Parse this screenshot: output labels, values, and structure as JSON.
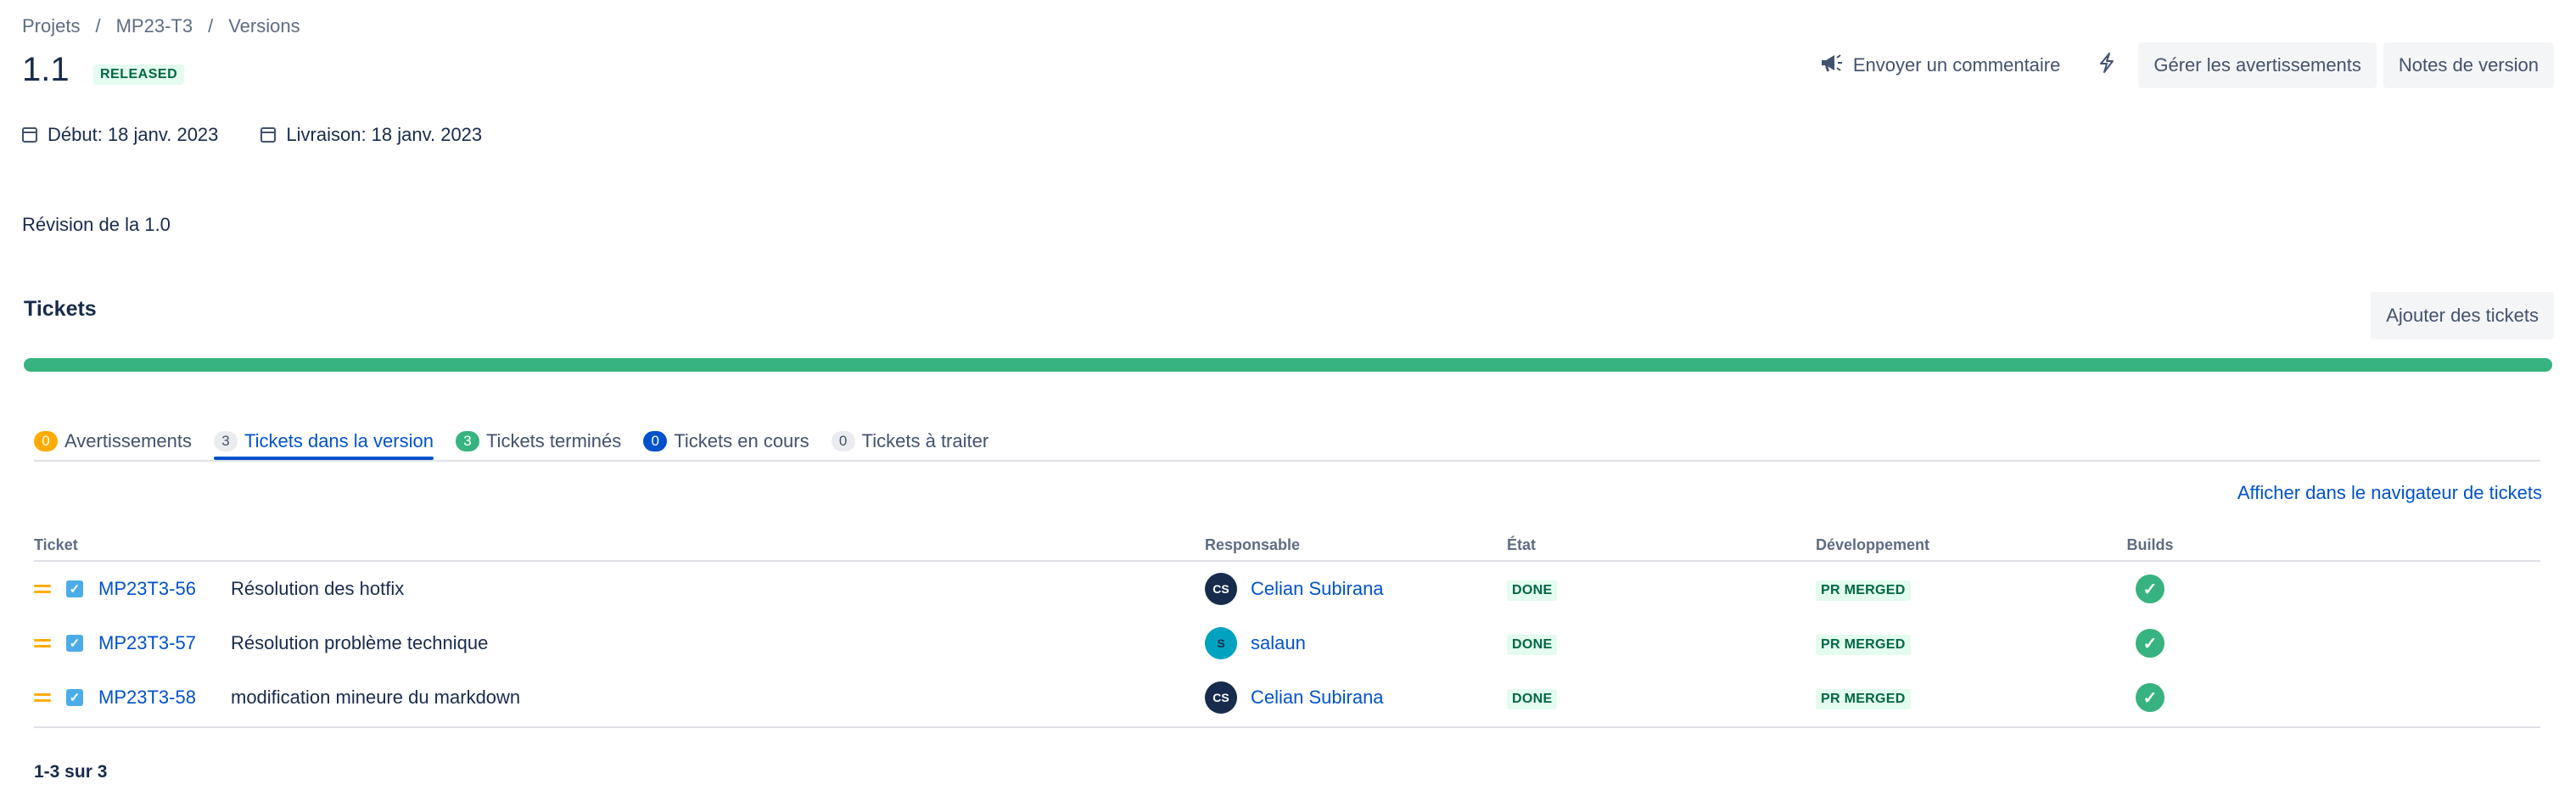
{
  "breadcrumb": [
    "Projets",
    "MP23-T3",
    "Versions"
  ],
  "breadcrumb_sep": "/",
  "version": {
    "name": "1.1",
    "status": "RELEASED",
    "start": "Début: 18 janv. 2023",
    "release": "Livraison: 18 janv. 2023",
    "description": "Révision de la 1.0"
  },
  "actions": {
    "feedback": "Envoyer un commentaire",
    "warnings": "Gérer les avertissements",
    "notes": "Notes de version"
  },
  "tickets_section": {
    "title": "Tickets",
    "add_button": "Ajouter des tickets",
    "progress": 1.0
  },
  "tabs": [
    {
      "count": "0",
      "label": "Avertissements",
      "color": "#ffab00"
    },
    {
      "count": "3",
      "label": "Tickets dans la version",
      "active": true
    },
    {
      "count": "3",
      "label": "Tickets terminés",
      "color": "#36b37e"
    },
    {
      "count": "0",
      "label": "Tickets en cours",
      "color": "#0052cc"
    },
    {
      "count": "0",
      "label": "Tickets à traiter"
    }
  ],
  "navigator_link": "Afficher dans le navigateur de tickets",
  "table": {
    "headers": [
      "Ticket",
      "Responsable",
      "État",
      "Développement",
      "Builds"
    ],
    "rows": [
      {
        "key": "MP23T3-56",
        "summary": "Résolution des hotfix",
        "assignee": "Celian Subirana",
        "initials": "CS",
        "state": "DONE",
        "dev": "PR MERGED"
      },
      {
        "key": "MP23T3-57",
        "summary": "Résolution problème technique",
        "assignee": "salaun",
        "initials": "S",
        "state": "DONE",
        "dev": "PR MERGED"
      },
      {
        "key": "MP23T3-58",
        "summary": "modification mineure du markdown",
        "assignee": "Celian Subirana",
        "initials": "CS",
        "state": "DONE",
        "dev": "PR MERGED"
      }
    ]
  },
  "pager": "1-3 sur 3"
}
